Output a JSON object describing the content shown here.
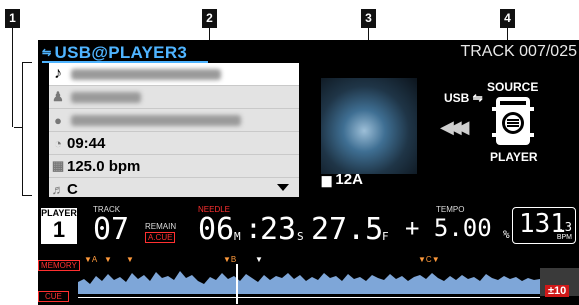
{
  "callouts": [
    "1",
    "2",
    "3",
    "4"
  ],
  "header": {
    "source": "USB@PLAYER3",
    "track_label": "TRACK",
    "track_number": "007/025"
  },
  "info": {
    "time": "09:44",
    "bpm": "125.0 bpm",
    "key": "C"
  },
  "album_key": "12A",
  "source_panel": {
    "usb_label": "USB",
    "source_label": "SOURCE",
    "player_label": "PLAYER"
  },
  "deck": {
    "player_title": "PLAYER",
    "player_number": "1",
    "track_title": "TRACK",
    "track_number": "07",
    "remain_label": "REMAIN",
    "acue_label": "A.CUE",
    "needle_label": "NEEDLE",
    "minutes": "06",
    "m_unit": "M",
    "seconds": "23",
    "s_unit": "S",
    "frames": "27.5",
    "f_unit": "F",
    "tempo_label": "TEMPO",
    "tempo_value": "+ 5.00",
    "tempo_unit": "%",
    "bpm_value": "131",
    "bpm_decimal": ".3",
    "bpm_unit": "BPM"
  },
  "waveform": {
    "memory_label": "MEMORY",
    "cue_label": "CUE",
    "markers": [
      "A",
      "B",
      "C"
    ],
    "pitch_range": "±10"
  },
  "icons": [
    "music-note-icon",
    "artist-icon",
    "album-icon",
    "clock-icon",
    "bpm-icon",
    "key-icon",
    "usb-icon",
    "player-device-icon",
    "play-reverse-icon",
    "key-tag-icon"
  ],
  "colors": {
    "source_blue": "#4fb4ff",
    "cue_red": "#ff3030",
    "marker_orange": "#ff9a3c",
    "waveform_blue": "#7ea6d8"
  }
}
